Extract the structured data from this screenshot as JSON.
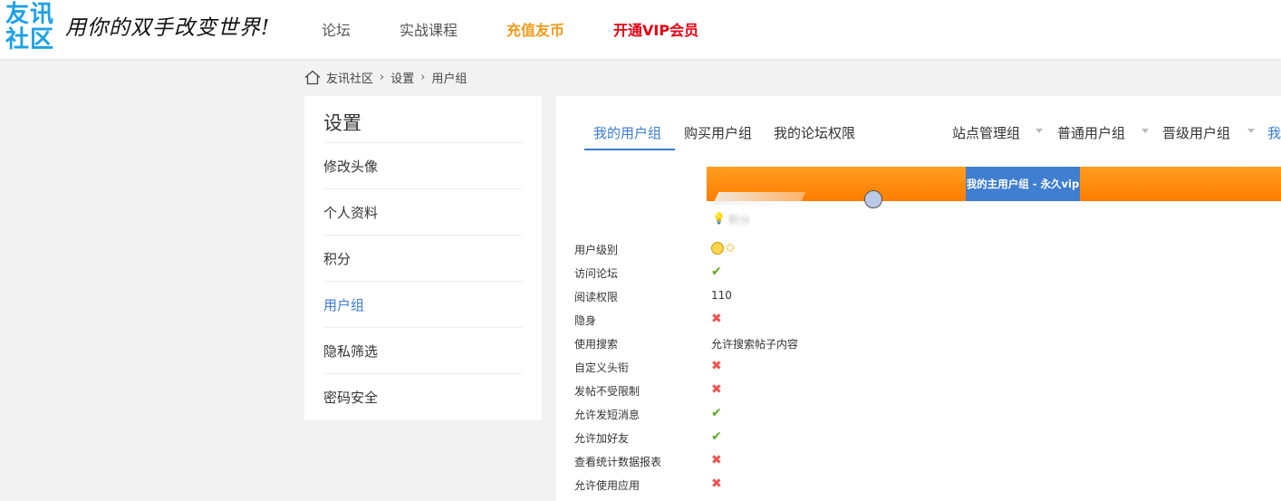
{
  "header": {
    "logo": {
      "line1": "友讯",
      "line2": "社区"
    },
    "slogan": "用你的双手改变世界!",
    "nav": [
      {
        "label": "论坛",
        "style": "normal"
      },
      {
        "label": "实战课程",
        "style": "normal"
      },
      {
        "label": "充值友币",
        "style": "orange"
      },
      {
        "label": "开通VIP会员",
        "style": "red"
      }
    ]
  },
  "breadcrumb": {
    "items": [
      "友讯社区",
      "设置",
      "用户组"
    ],
    "separator": "›"
  },
  "sidebar": {
    "title": "设置",
    "items": [
      {
        "label": "修改头像",
        "active": false
      },
      {
        "label": "个人资料",
        "active": false
      },
      {
        "label": "积分",
        "active": false
      },
      {
        "label": "用户组",
        "active": true
      },
      {
        "label": "隐私筛选",
        "active": false
      },
      {
        "label": "密码安全",
        "active": false
      }
    ]
  },
  "main": {
    "tabs": [
      {
        "label": "我的用户组",
        "active": true
      },
      {
        "label": "购买用户组",
        "active": false
      },
      {
        "label": "我的论坛权限",
        "active": false
      }
    ],
    "dropdown_tabs": [
      "站点管理组",
      "普通用户组",
      "晋级用户组",
      "我"
    ],
    "group_banner": "我的主用户组 - 永久vip",
    "blurred_label": "积分",
    "permissions": [
      {
        "label": "用户级别",
        "type": "level"
      },
      {
        "label": "访问论坛",
        "type": "check"
      },
      {
        "label": "阅读权限",
        "type": "text",
        "value": "110"
      },
      {
        "label": "隐身",
        "type": "cross"
      },
      {
        "label": "使用搜索",
        "type": "text",
        "value": "允许搜索帖子内容"
      },
      {
        "label": "自定义头衔",
        "type": "cross"
      },
      {
        "label": "发帖不受限制",
        "type": "cross"
      },
      {
        "label": "允许发短消息",
        "type": "check"
      },
      {
        "label": "允许加好友",
        "type": "check"
      },
      {
        "label": "查看统计数据报表",
        "type": "cross"
      },
      {
        "label": "允许使用应用",
        "type": "cross"
      }
    ],
    "symbols": {
      "check": "✔",
      "cross": "✖"
    }
  },
  "colors": {
    "accent": "#3a7bd5",
    "orange": "#f39a1b",
    "red": "#e60012",
    "bar": "#ff8a00"
  }
}
